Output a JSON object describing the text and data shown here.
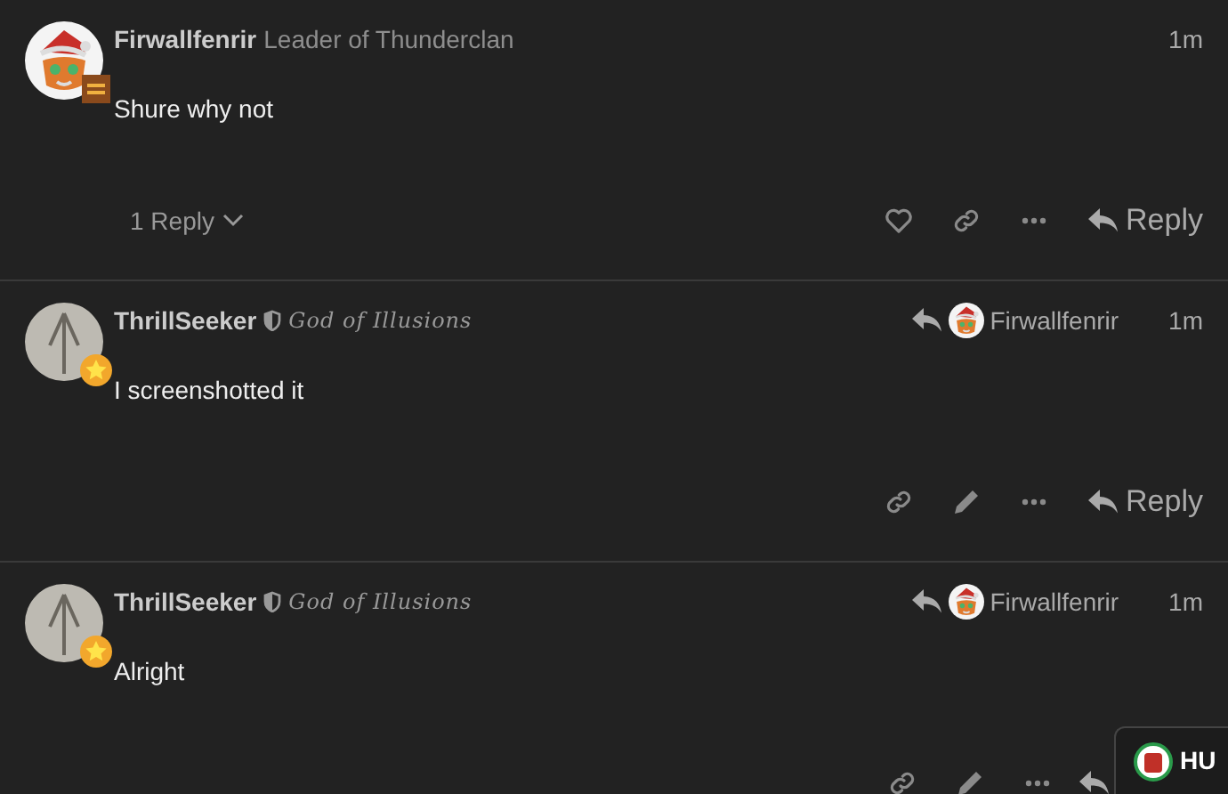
{
  "posts": [
    {
      "kind": "leader",
      "author": "Firwallfenrir",
      "title": "Leader of Thunderclan",
      "time": "1m",
      "body": "Shure why not",
      "replies_toggle": {
        "label": "1 Reply",
        "expanded": false
      },
      "actions": [
        {
          "kind": "like"
        },
        {
          "kind": "link"
        },
        {
          "kind": "more"
        },
        {
          "kind": "reply",
          "label": "Reply"
        }
      ]
    },
    {
      "kind": "moderator",
      "author": "ThrillSeeker",
      "title": "God of Illusions",
      "reply_to": {
        "name": "Firwallfenrir"
      },
      "time": "1m",
      "body": "I screenshotted it",
      "actions": [
        {
          "kind": "link"
        },
        {
          "kind": "edit"
        },
        {
          "kind": "more"
        },
        {
          "kind": "reply",
          "label": "Reply"
        }
      ]
    },
    {
      "kind": "moderator",
      "author": "ThrillSeeker",
      "title": "God of Illusions",
      "reply_to": {
        "name": "Firwallfenrir"
      },
      "time": "1m",
      "body": "Alright",
      "actions": [
        {
          "kind": "link"
        },
        {
          "kind": "edit"
        },
        {
          "kind": "more"
        },
        {
          "kind": "reply"
        }
      ]
    }
  ],
  "floating_chip": {
    "label": "HU"
  }
}
